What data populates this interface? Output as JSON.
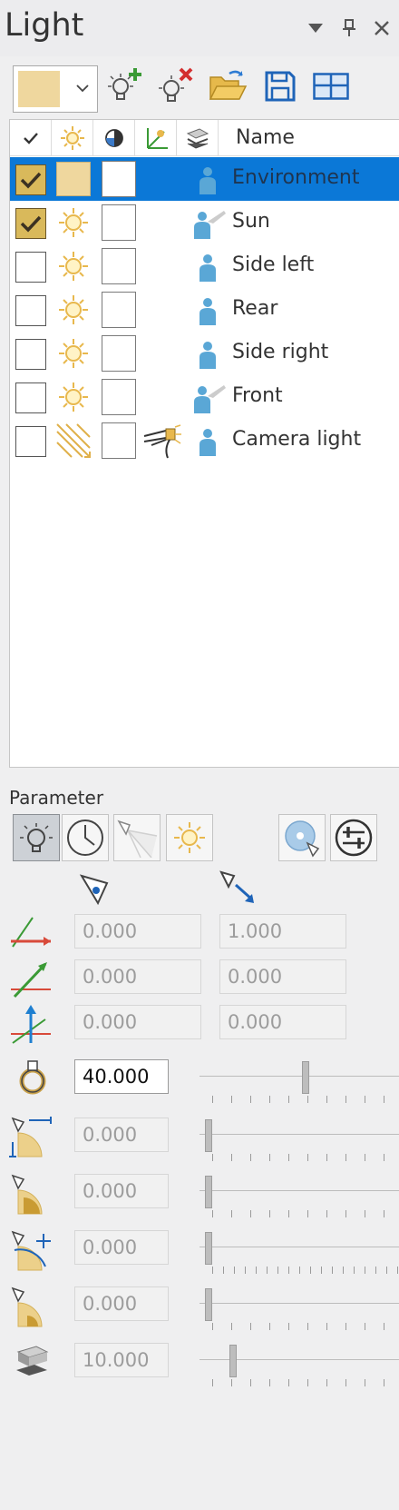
{
  "panel": {
    "title": "Light"
  },
  "icons": {
    "dropdown": "chevron-down-icon",
    "pin": "pin-icon",
    "close": "close-icon"
  },
  "colors": {
    "selection": "#0b78d7",
    "swatch": "#efd79e",
    "checked": "#d9b95b",
    "person": "#5aa7d6",
    "sun": "#e8b84d"
  },
  "list": {
    "headers": {
      "name": "Name"
    },
    "rows": [
      {
        "name": "Environment",
        "checked": true,
        "selected": true
      },
      {
        "name": "Sun",
        "checked": true,
        "selected": false
      },
      {
        "name": "Side left",
        "checked": false,
        "selected": false
      },
      {
        "name": "Rear",
        "checked": false,
        "selected": false
      },
      {
        "name": "Side right",
        "checked": false,
        "selected": false
      },
      {
        "name": "Front",
        "checked": false,
        "selected": false
      },
      {
        "name": "Camera light",
        "checked": false,
        "selected": false
      }
    ]
  },
  "parameter": {
    "label": "Parameter",
    "position_x": {
      "a": "0.000",
      "b": "1.000"
    },
    "position_y": {
      "a": "0.000",
      "b": "0.000"
    },
    "position_z": {
      "a": "0.000",
      "b": "0.000"
    },
    "intensity": "40.000",
    "cone_1": "0.000",
    "cone_2": "0.000",
    "cone_3": "0.000",
    "cone_4": "0.000",
    "shadow": "10.000",
    "slider_levels": {
      "intensity": 0.4,
      "cone_1": 0,
      "cone_2": 0,
      "cone_3": 0,
      "cone_4": 0,
      "shadow": 0.1
    }
  }
}
